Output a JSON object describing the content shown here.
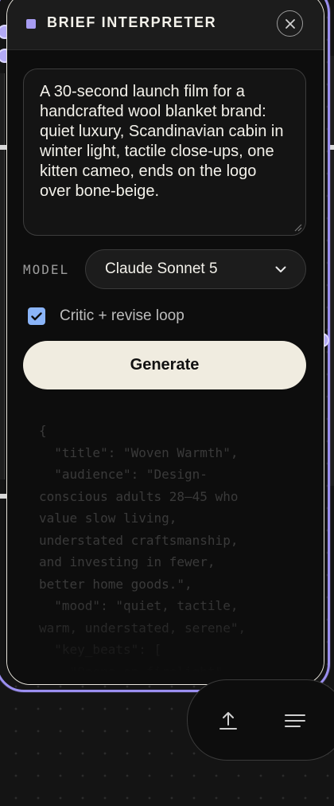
{
  "panel": {
    "title": "BRIEF INTERPRETER",
    "accent_color": "#a79cf2",
    "selection_color": "#9b8ff0"
  },
  "brief": {
    "value": "A 30-second launch film for a handcrafted wool blanket brand: quiet luxury, Scandinavian cabin in winter light, tactile close-ups, one kitten cameo, ends on the logo over bone-beige."
  },
  "model": {
    "label": "MODEL",
    "selected": "Claude Sonnet 5"
  },
  "critic": {
    "label": "Critic + revise loop",
    "checked": true
  },
  "generate": {
    "label": "Generate"
  },
  "output": {
    "json_text": "{\n  \"title\": \"Woven Warmth\",\n  \"audience\": \"Design-\nconscious adults 28–45 who\nvalue slow living,\nunderstated craftsmanship,\nand investing in fewer,\nbetter home goods.\",\n  \"mood\": \"quiet, tactile,\nwarm, understated, serene\",\n  \"key_beats\": [\n    \"Opens on firelight\""
  },
  "dock": {
    "upload_icon": "upload-icon",
    "menu_icon": "menu-icon"
  }
}
